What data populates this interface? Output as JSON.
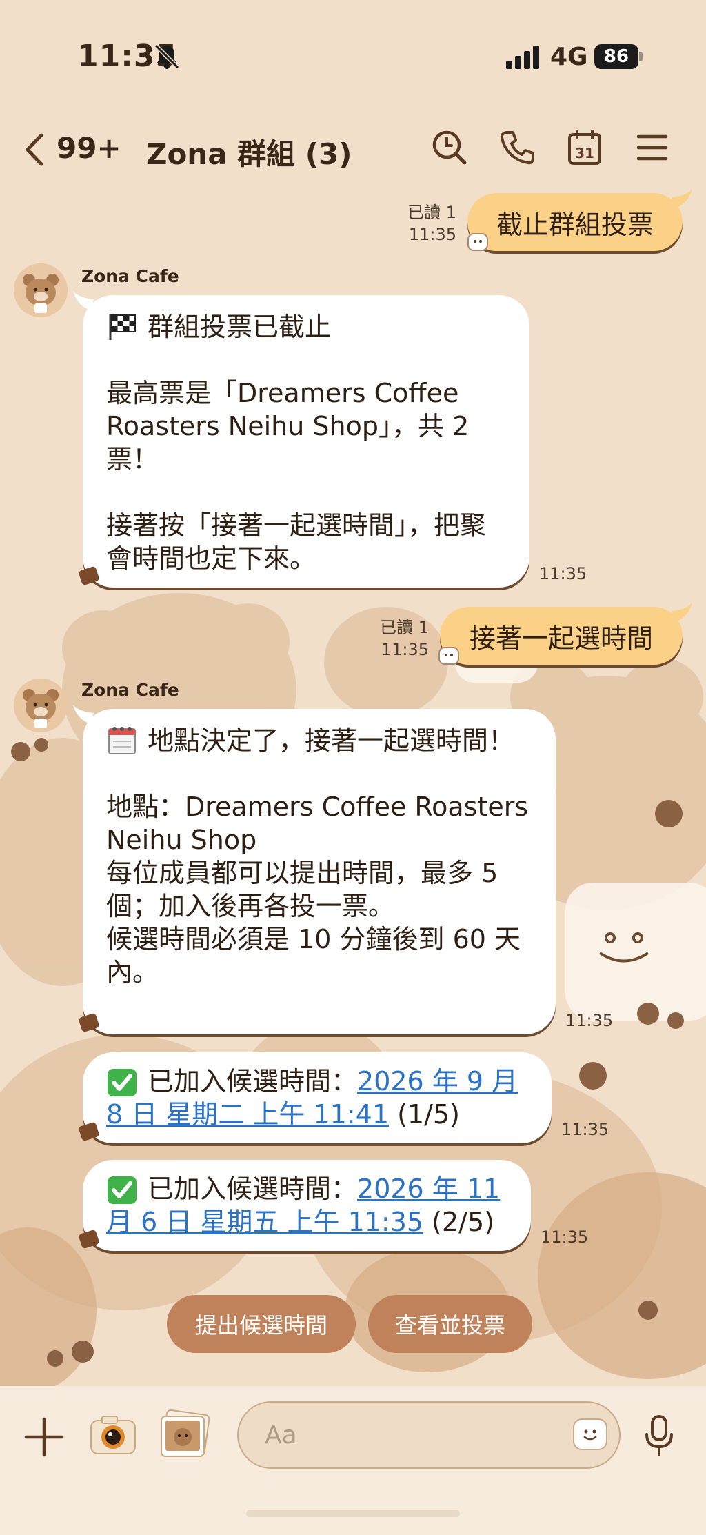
{
  "status": {
    "time": "11:35",
    "network": "4G",
    "battery": "86"
  },
  "header": {
    "back_count": "99+",
    "title": "Zona 群組 (3)"
  },
  "messages": {
    "out1": {
      "text": "截止群組投票",
      "read": "已讀 1",
      "time": "11:35"
    },
    "in1": {
      "sender": "Zona Cafe",
      "line1": "群組投票已截止",
      "line2": "最高票是「Dreamers Coffee Roasters Neihu Shop」，共 2 票！",
      "line3": "接著按「接著一起選時間」，把聚會時間也定下來。",
      "time": "11:35"
    },
    "out2": {
      "text": "接著一起選時間",
      "read": "已讀 1",
      "time": "11:35"
    },
    "in2": {
      "sender": "Zona Cafe",
      "line1": "地點決定了，接著一起選時間！",
      "line2": "地點：Dreamers Coffee Roasters Neihu Shop",
      "line3": "每位成員都可以提出時間，最多 5 個；加入後再各投一票。",
      "line4": "候選時間必須是 10 分鐘後到 60 天內。",
      "time": "11:35"
    },
    "in3": {
      "prefix": "已加入候選時間：",
      "link": "2026 年 9 月 8 日 星期二 上午 11:41",
      "suffix": " (1/5)",
      "time": "11:35"
    },
    "in4": {
      "prefix": "已加入候選時間：",
      "link": "2026 年 11 月 6 日 星期五 上午 11:35",
      "suffix": " (2/5)",
      "time": "11:35"
    }
  },
  "quick_replies": {
    "propose": "提出候選時間",
    "view_vote": "查看並投票"
  },
  "input": {
    "placeholder": "Aa"
  },
  "icons": {
    "back": "chevron-left-icon",
    "search": "search-icon",
    "call": "phone-icon",
    "calendar": "calendar-icon",
    "menu": "menu-icon",
    "plus": "plus-icon",
    "camera": "camera-icon",
    "photo": "photo-icon",
    "emoji": "emoji-icon",
    "mic": "mic-icon",
    "calendar_day": "31"
  },
  "colors": {
    "bubble_out": "#fbd188",
    "quick_reply": "#c0825b",
    "link": "#2b73c7",
    "background": "#f1dfca"
  }
}
